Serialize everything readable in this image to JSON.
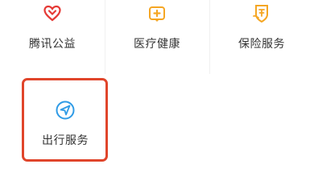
{
  "services": [
    {
      "label": "腾讯公益",
      "icon": "heart-charity-icon",
      "color": "#e53935"
    },
    {
      "label": "医疗健康",
      "icon": "medical-kit-icon",
      "color": "#f5a623"
    },
    {
      "label": "保险服务",
      "icon": "insurance-shield-icon",
      "color": "#f5a623"
    },
    {
      "label": "出行服务",
      "icon": "navigation-arrow-icon",
      "color": "#2f9be6"
    }
  ],
  "highlight": {
    "target": "出行服务",
    "color": "#e0452b"
  }
}
